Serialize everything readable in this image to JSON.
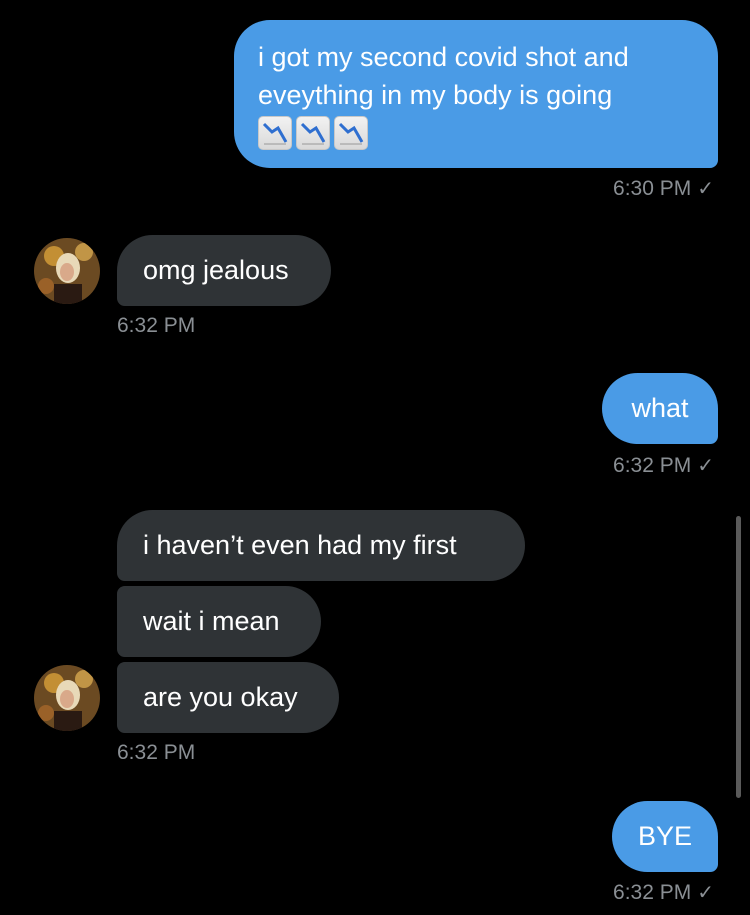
{
  "messages": [
    {
      "id": "m1",
      "direction": "sent",
      "lines": [
        "i got my second covid shot and",
        "eveything in my body is going"
      ],
      "emoji": [
        "chart-decreasing-icon",
        "chart-decreasing-icon",
        "chart-decreasing-icon"
      ],
      "time": "6:30 PM"
    },
    {
      "id": "m2",
      "direction": "received",
      "text": "omg jealous",
      "time": "6:32 PM"
    },
    {
      "id": "m3",
      "direction": "sent",
      "text": "what",
      "time": "6:32 PM"
    },
    {
      "id": "m4",
      "direction": "received",
      "text": "i haven’t even had my first"
    },
    {
      "id": "m5",
      "direction": "received",
      "text": "wait i mean"
    },
    {
      "id": "m6",
      "direction": "received",
      "text": "are you okay",
      "time": "6:32 PM"
    },
    {
      "id": "m7",
      "direction": "sent",
      "text": "BYE",
      "time": "6:32 PM"
    }
  ],
  "read_check": "✓",
  "colors": {
    "sent_bubble": "#4a9be6",
    "received_bubble": "#2f3336",
    "background": "#000000",
    "timestamp": "#8a8f94"
  }
}
